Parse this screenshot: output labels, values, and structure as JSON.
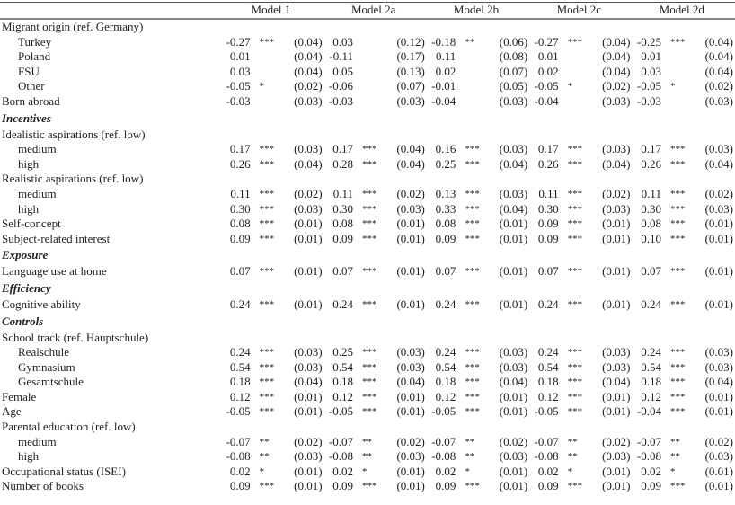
{
  "table": {
    "models": [
      "Model 1",
      "Model 2a",
      "Model 2b",
      "Model 2c",
      "Model 2d"
    ],
    "rows": [
      {
        "label": "Migrant origin (ref. Germany)",
        "type": "group",
        "cells": []
      },
      {
        "label": "Turkey",
        "type": "sub",
        "cells": [
          [
            "-0.27",
            "***",
            "(0.04)"
          ],
          [
            "0.03",
            "",
            "(0.12)"
          ],
          [
            "-0.18",
            "**",
            "(0.06)"
          ],
          [
            "-0.27",
            "***",
            "(0.04)"
          ],
          [
            "-0.25",
            "***",
            "(0.04)"
          ]
        ]
      },
      {
        "label": "Poland",
        "type": "sub",
        "cells": [
          [
            "0.01",
            "",
            "(0.04)"
          ],
          [
            "-0.11",
            "",
            "(0.17)"
          ],
          [
            "0.11",
            "",
            "(0.08)"
          ],
          [
            "0.01",
            "",
            "(0.04)"
          ],
          [
            "0.01",
            "",
            "(0.04)"
          ]
        ]
      },
      {
        "label": "FSU",
        "type": "sub",
        "cells": [
          [
            "0.03",
            "",
            "(0.04)"
          ],
          [
            "0.05",
            "",
            "(0.13)"
          ],
          [
            "0.02",
            "",
            "(0.07)"
          ],
          [
            "0.02",
            "",
            "(0.04)"
          ],
          [
            "0.03",
            "",
            "(0.04)"
          ]
        ]
      },
      {
        "label": "Other",
        "type": "sub",
        "cells": [
          [
            "-0.05",
            "*",
            "(0.02)"
          ],
          [
            "-0.06",
            "",
            "(0.07)"
          ],
          [
            "-0.01",
            "",
            "(0.05)"
          ],
          [
            "-0.05",
            "*",
            "(0.02)"
          ],
          [
            "-0.05",
            "*",
            "(0.02)"
          ]
        ]
      },
      {
        "label": "Born abroad",
        "type": "var",
        "cells": [
          [
            "-0.03",
            "",
            "(0.03)"
          ],
          [
            "-0.03",
            "",
            "(0.03)"
          ],
          [
            "-0.04",
            "",
            "(0.03)"
          ],
          [
            "-0.04",
            "",
            "(0.03)"
          ],
          [
            "-0.03",
            "",
            "(0.03)"
          ]
        ]
      },
      {
        "label": "Incentives",
        "type": "section",
        "cells": []
      },
      {
        "label": "Idealistic aspirations (ref. low)",
        "type": "group",
        "cells": []
      },
      {
        "label": "medium",
        "type": "sub",
        "cells": [
          [
            "0.17",
            "***",
            "(0.03)"
          ],
          [
            "0.17",
            "***",
            "(0.04)"
          ],
          [
            "0.16",
            "***",
            "(0.03)"
          ],
          [
            "0.17",
            "***",
            "(0.03)"
          ],
          [
            "0.17",
            "***",
            "(0.03)"
          ]
        ]
      },
      {
        "label": "high",
        "type": "sub",
        "cells": [
          [
            "0.26",
            "***",
            "(0.04)"
          ],
          [
            "0.28",
            "***",
            "(0.04)"
          ],
          [
            "0.25",
            "***",
            "(0.04)"
          ],
          [
            "0.26",
            "***",
            "(0.04)"
          ],
          [
            "0.26",
            "***",
            "(0.04)"
          ]
        ]
      },
      {
        "label": "Realistic aspirations (ref. low)",
        "type": "group",
        "cells": []
      },
      {
        "label": "medium",
        "type": "sub",
        "cells": [
          [
            "0.11",
            "***",
            "(0.02)"
          ],
          [
            "0.11",
            "***",
            "(0.02)"
          ],
          [
            "0.13",
            "***",
            "(0.03)"
          ],
          [
            "0.11",
            "***",
            "(0.02)"
          ],
          [
            "0.11",
            "***",
            "(0.02)"
          ]
        ]
      },
      {
        "label": "high",
        "type": "sub",
        "cells": [
          [
            "0.30",
            "***",
            "(0.03)"
          ],
          [
            "0.30",
            "***",
            "(0.03)"
          ],
          [
            "0.33",
            "***",
            "(0.04)"
          ],
          [
            "0.30",
            "***",
            "(0.03)"
          ],
          [
            "0.30",
            "***",
            "(0.03)"
          ]
        ]
      },
      {
        "label": "Self-concept",
        "type": "var",
        "cells": [
          [
            "0.08",
            "***",
            "(0.01)"
          ],
          [
            "0.08",
            "***",
            "(0.01)"
          ],
          [
            "0.08",
            "***",
            "(0.01)"
          ],
          [
            "0.09",
            "***",
            "(0.01)"
          ],
          [
            "0.08",
            "***",
            "(0.01)"
          ]
        ]
      },
      {
        "label": "Subject-related interest",
        "type": "var",
        "cells": [
          [
            "0.09",
            "***",
            "(0.01)"
          ],
          [
            "0.09",
            "***",
            "(0.01)"
          ],
          [
            "0.09",
            "***",
            "(0.01)"
          ],
          [
            "0.09",
            "***",
            "(0.01)"
          ],
          [
            "0.10",
            "***",
            "(0.01)"
          ]
        ]
      },
      {
        "label": "Exposure",
        "type": "section",
        "cells": []
      },
      {
        "label": "Language use at home",
        "type": "var",
        "cells": [
          [
            "0.07",
            "***",
            "(0.01)"
          ],
          [
            "0.07",
            "***",
            "(0.01)"
          ],
          [
            "0.07",
            "***",
            "(0.01)"
          ],
          [
            "0.07",
            "***",
            "(0.01)"
          ],
          [
            "0.07",
            "***",
            "(0.01)"
          ]
        ]
      },
      {
        "label": "Efficiency",
        "type": "section",
        "cells": []
      },
      {
        "label": "Cognitive ability",
        "type": "var",
        "cells": [
          [
            "0.24",
            "***",
            "(0.01)"
          ],
          [
            "0.24",
            "***",
            "(0.01)"
          ],
          [
            "0.24",
            "***",
            "(0.01)"
          ],
          [
            "0.24",
            "***",
            "(0.01)"
          ],
          [
            "0.24",
            "***",
            "(0.01)"
          ]
        ]
      },
      {
        "label": "Controls",
        "type": "section",
        "cells": []
      },
      {
        "label": "School track (ref. Hauptschule)",
        "type": "group",
        "cells": []
      },
      {
        "label": "Realschule",
        "type": "sub",
        "cells": [
          [
            "0.24",
            "***",
            "(0.03)"
          ],
          [
            "0.25",
            "***",
            "(0.03)"
          ],
          [
            "0.24",
            "***",
            "(0.03)"
          ],
          [
            "0.24",
            "***",
            "(0.03)"
          ],
          [
            "0.24",
            "***",
            "(0.03)"
          ]
        ]
      },
      {
        "label": "Gymnasium",
        "type": "sub",
        "cells": [
          [
            "0.54",
            "***",
            "(0.03)"
          ],
          [
            "0.54",
            "***",
            "(0.03)"
          ],
          [
            "0.54",
            "***",
            "(0.03)"
          ],
          [
            "0.54",
            "***",
            "(0.03)"
          ],
          [
            "0.54",
            "***",
            "(0.03)"
          ]
        ]
      },
      {
        "label": "Gesamtschule",
        "type": "sub",
        "cells": [
          [
            "0.18",
            "***",
            "(0.04)"
          ],
          [
            "0.18",
            "***",
            "(0.04)"
          ],
          [
            "0.18",
            "***",
            "(0.04)"
          ],
          [
            "0.18",
            "***",
            "(0.04)"
          ],
          [
            "0.18",
            "***",
            "(0.04)"
          ]
        ]
      },
      {
        "label": "Female",
        "type": "var",
        "cells": [
          [
            "0.12",
            "***",
            "(0.01)"
          ],
          [
            "0.12",
            "***",
            "(0.01)"
          ],
          [
            "0.12",
            "***",
            "(0.01)"
          ],
          [
            "0.12",
            "***",
            "(0.01)"
          ],
          [
            "0.12",
            "***",
            "(0.01)"
          ]
        ]
      },
      {
        "label": "Age",
        "type": "var",
        "cells": [
          [
            "-0.05",
            "***",
            "(0.01)"
          ],
          [
            "-0.05",
            "***",
            "(0.01)"
          ],
          [
            "-0.05",
            "***",
            "(0.01)"
          ],
          [
            "-0.05",
            "***",
            "(0.01)"
          ],
          [
            "-0.04",
            "***",
            "(0.01)"
          ]
        ]
      },
      {
        "label": "Parental education (ref. low)",
        "type": "group",
        "cells": []
      },
      {
        "label": "medium",
        "type": "sub",
        "cells": [
          [
            "-0.07",
            "**",
            "(0.02)"
          ],
          [
            "-0.07",
            "**",
            "(0.02)"
          ],
          [
            "-0.07",
            "**",
            "(0.02)"
          ],
          [
            "-0.07",
            "**",
            "(0.02)"
          ],
          [
            "-0.07",
            "**",
            "(0.02)"
          ]
        ]
      },
      {
        "label": "high",
        "type": "sub",
        "cells": [
          [
            "-0.08",
            "**",
            "(0.03)"
          ],
          [
            "-0.08",
            "**",
            "(0.03)"
          ],
          [
            "-0.08",
            "**",
            "(0.03)"
          ],
          [
            "-0.08",
            "**",
            "(0.03)"
          ],
          [
            "-0.08",
            "**",
            "(0.03)"
          ]
        ]
      },
      {
        "label": "Occupational status (ISEI)",
        "type": "var",
        "cells": [
          [
            "0.02",
            "*",
            "(0.01)"
          ],
          [
            "0.02",
            "*",
            "(0.01)"
          ],
          [
            "0.02",
            "*",
            "(0.01)"
          ],
          [
            "0.02",
            "*",
            "(0.01)"
          ],
          [
            "0.02",
            "*",
            "(0.01)"
          ]
        ]
      },
      {
        "label": "Number of books",
        "type": "var",
        "cells": [
          [
            "0.09",
            "***",
            "(0.01)"
          ],
          [
            "0.09",
            "***",
            "(0.01)"
          ],
          [
            "0.09",
            "***",
            "(0.01)"
          ],
          [
            "0.09",
            "***",
            "(0.01)"
          ],
          [
            "0.09",
            "***",
            "(0.01)"
          ]
        ]
      }
    ]
  }
}
